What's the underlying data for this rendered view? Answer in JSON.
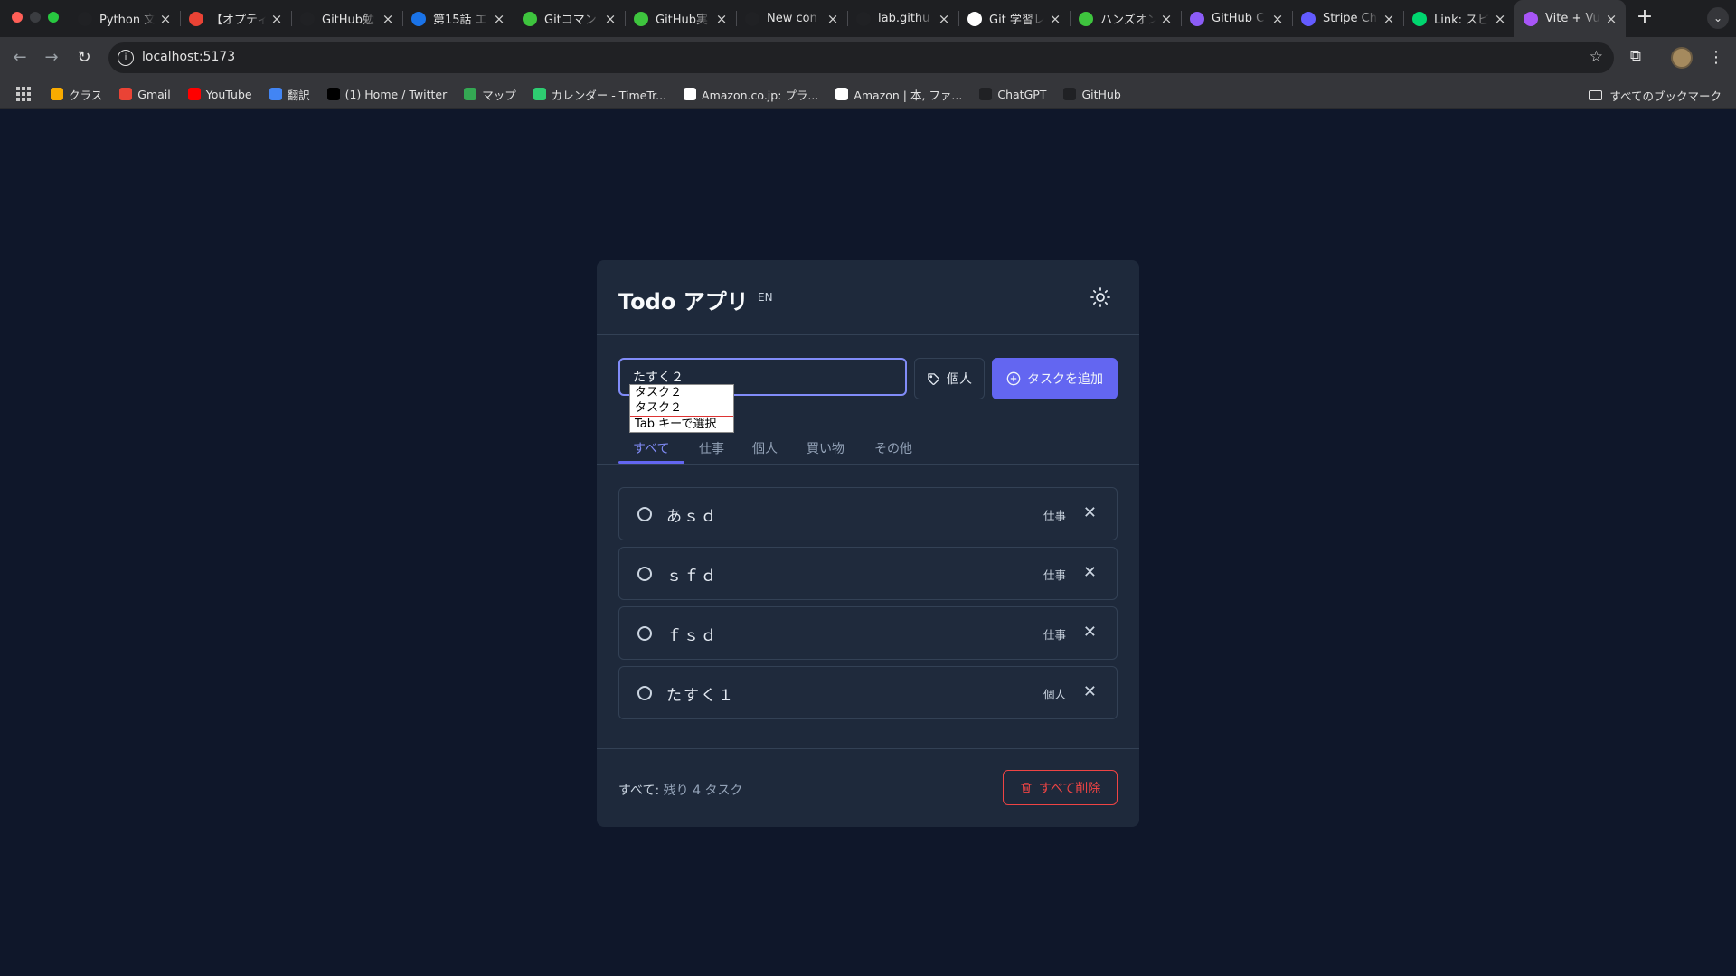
{
  "browser": {
    "tabs": [
      {
        "title": "Python 文",
        "icon": "openai-icon",
        "color": "#202124"
      },
      {
        "title": "【オプティ",
        "icon": "gmail-icon",
        "color": "#ea4335"
      },
      {
        "title": "GitHub勉",
        "icon": "openai-icon",
        "color": "#202124"
      },
      {
        "title": "第15話 エ",
        "icon": "it-icon",
        "color": "#1a73e8"
      },
      {
        "title": "Gitコマン",
        "icon": "green-icon",
        "color": "#3ec43e"
      },
      {
        "title": "GitHub実",
        "icon": "green-icon",
        "color": "#3ec43e"
      },
      {
        "title": "New con",
        "icon": "github-icon",
        "color": "#202124"
      },
      {
        "title": "lab.githu",
        "icon": "globe-icon",
        "color": "#202124"
      },
      {
        "title": "Git 学習レ",
        "icon": "p-icon",
        "color": "#ffffff"
      },
      {
        "title": "ハンズオン",
        "icon": "green-icon",
        "color": "#3ec43e"
      },
      {
        "title": "GitHub C",
        "icon": "purple-icon",
        "color": "#8b5cf6"
      },
      {
        "title": "Stripe Ch",
        "icon": "stripe-icon",
        "color": "#635bff"
      },
      {
        "title": "Link: スピ",
        "icon": "link-icon",
        "color": "#00d66f"
      },
      {
        "title": "Vite + Vu",
        "icon": "vite-icon",
        "color": "#a855f7",
        "active": true
      }
    ],
    "url": "localhost:5173",
    "bookmarks": [
      {
        "label": "クラス",
        "icon": "classroom-icon",
        "color": "#f9ab00"
      },
      {
        "label": "Gmail",
        "icon": "gmail-icon",
        "color": "#ea4335"
      },
      {
        "label": "YouTube",
        "icon": "youtube-icon",
        "color": "#ff0000"
      },
      {
        "label": "翻訳",
        "icon": "translate-icon",
        "color": "#4285f4"
      },
      {
        "label": "(1) Home / Twitter",
        "icon": "x-icon",
        "color": "#000000"
      },
      {
        "label": "マップ",
        "icon": "maps-icon",
        "color": "#34a853"
      },
      {
        "label": "カレンダー - TimeTr...",
        "icon": "timetree-icon",
        "color": "#2ecc71"
      },
      {
        "label": "Amazon.co.jp: プラ...",
        "icon": "amazon-icon",
        "color": "#ffffff"
      },
      {
        "label": "Amazon | 本, ファ...",
        "icon": "amazon-icon",
        "color": "#ffffff"
      },
      {
        "label": "ChatGPT",
        "icon": "openai-icon",
        "color": "#202124"
      },
      {
        "label": "GitHub",
        "icon": "github-icon",
        "color": "#202124"
      }
    ],
    "all_bookmarks": "すべてのブックマーク"
  },
  "app": {
    "title": "Todo アプリ",
    "lang_toggle": "EN",
    "input": {
      "value": "たすく２",
      "placeholder": ""
    },
    "category_button": "個人",
    "add_button": "タスクを追加",
    "suggestions": [
      "タスク２",
      "タスク２"
    ],
    "suggestion_hint": "Tab キーで選択",
    "filters": [
      "すべて",
      "仕事",
      "個人",
      "買い物",
      "その他"
    ],
    "active_filter": "すべて",
    "todos": [
      {
        "text": "あｓｄ",
        "tag": "仕事"
      },
      {
        "text": "ｓｆｄ",
        "tag": "仕事"
      },
      {
        "text": "ｆｓｄ",
        "tag": "仕事"
      },
      {
        "text": "たすく１",
        "tag": "個人"
      }
    ],
    "footer": {
      "label": "すべて:",
      "count": "残り 4 タスク"
    },
    "clear_button": "すべて削除"
  }
}
